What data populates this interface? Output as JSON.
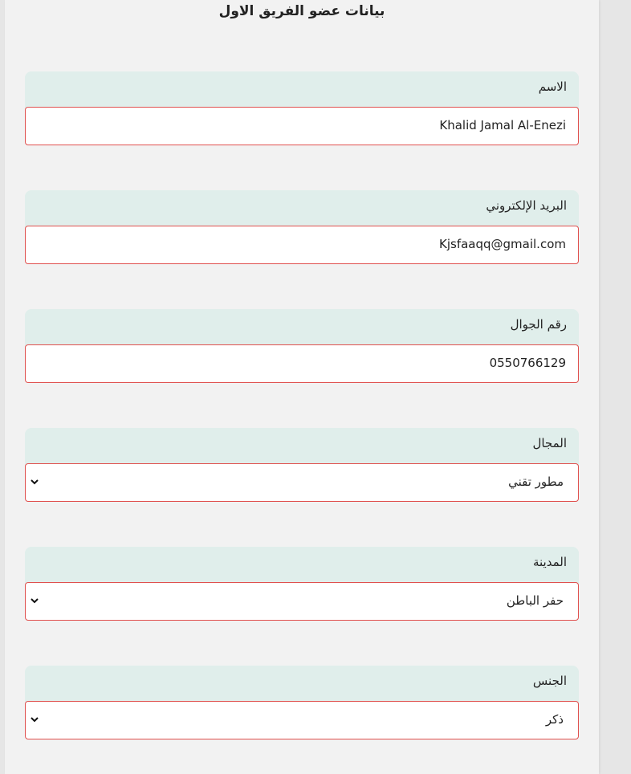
{
  "form": {
    "title": "بيانات عضو الفريق الاول",
    "fields": [
      {
        "label": "الاسم",
        "value": "Khalid Jamal Al-Enezi",
        "type": "text"
      },
      {
        "label": "البريد الإلكتروني",
        "value": "Kjsfaaqq@gmail.com",
        "type": "text"
      },
      {
        "label": "رقم الجوال",
        "value": "0550766129",
        "type": "text"
      },
      {
        "label": "المجال",
        "value": "مطور تقني",
        "type": "select"
      },
      {
        "label": "المدينة",
        "value": "حفر الباطن",
        "type": "select"
      },
      {
        "label": "الجنس",
        "value": "ذكر",
        "type": "select"
      }
    ]
  },
  "colors": {
    "page_background": "#f2f2f2",
    "label_background": "#e0eeeb",
    "input_border": "#e0504e",
    "input_background": "#ffffff"
  },
  "icons": {
    "select_arrow": "chevron-down-icon"
  }
}
